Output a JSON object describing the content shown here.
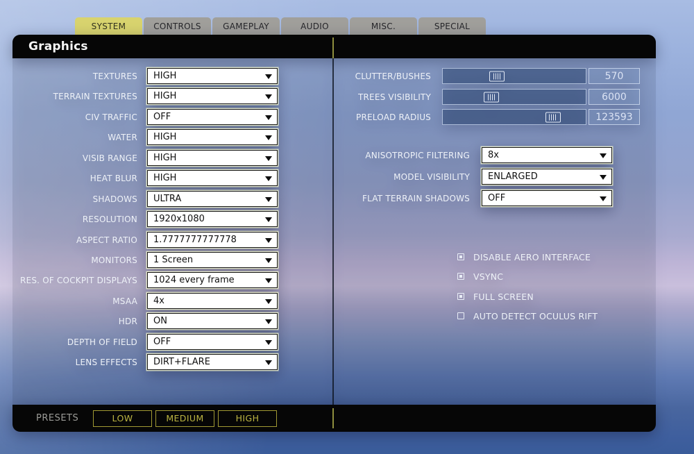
{
  "tabs": [
    {
      "label": "SYSTEM",
      "active": true
    },
    {
      "label": "CONTROLS",
      "active": false
    },
    {
      "label": "GAMEPLAY",
      "active": false
    },
    {
      "label": "AUDIO",
      "active": false
    },
    {
      "label": "MISC.",
      "active": false
    },
    {
      "label": "SPECIAL",
      "active": false
    }
  ],
  "panel": {
    "title": "Graphics"
  },
  "left_settings": [
    {
      "label": "TEXTURES",
      "value": "HIGH"
    },
    {
      "label": "TERRAIN TEXTURES",
      "value": "HIGH"
    },
    {
      "label": "CIV TRAFFIC",
      "value": "OFF"
    },
    {
      "label": "WATER",
      "value": "HIGH"
    },
    {
      "label": "VISIB RANGE",
      "value": "HIGH"
    },
    {
      "label": "HEAT BLUR",
      "value": "HIGH"
    },
    {
      "label": "SHADOWS",
      "value": "ULTRA"
    },
    {
      "label": "RESOLUTION",
      "value": "1920x1080"
    },
    {
      "label": "ASPECT RATIO",
      "value": "1.7777777777778"
    },
    {
      "label": "MONITORS",
      "value": "1 Screen"
    },
    {
      "label": "RES. OF COCKPIT DISPLAYS",
      "value": "1024 every frame"
    },
    {
      "label": "MSAA",
      "value": "4x"
    },
    {
      "label": "HDR",
      "value": "ON"
    },
    {
      "label": "DEPTH OF FIELD",
      "value": "OFF"
    },
    {
      "label": "LENS EFFECTS",
      "value": "DIRT+FLARE"
    }
  ],
  "sliders": [
    {
      "label": "CLUTTER/BUSHES",
      "value": "570",
      "thumb_style": "left:38%"
    },
    {
      "label": "TREES VISIBILITY",
      "value": "6000",
      "thumb_style": "left:34%"
    },
    {
      "label": "PRELOAD RADIUS",
      "value": "123593",
      "thumb_style": "left:77%"
    }
  ],
  "right_settings": [
    {
      "label": "ANISOTROPIC FILTERING",
      "value": "8x"
    },
    {
      "label": "MODEL VISIBILITY",
      "value": "ENLARGED"
    },
    {
      "label": "FLAT TERRAIN SHADOWS",
      "value": "OFF"
    }
  ],
  "checkboxes": [
    {
      "label": "DISABLE AERO INTERFACE",
      "checked": true
    },
    {
      "label": "VSYNC",
      "checked": true
    },
    {
      "label": "FULL SCREEN",
      "checked": true
    },
    {
      "label": "AUTO DETECT OCULUS RIFT",
      "checked": false
    }
  ],
  "footer": {
    "presets_label": "PRESETS",
    "buttons": [
      "LOW",
      "MEDIUM",
      "HIGH"
    ]
  },
  "colors": {
    "active_tab": "#d8d36e",
    "inactive_tab": "#a09f9b",
    "panel_black": "#060606",
    "preset_accent": "#b3ad3e",
    "label_text": "#eef2f8"
  }
}
